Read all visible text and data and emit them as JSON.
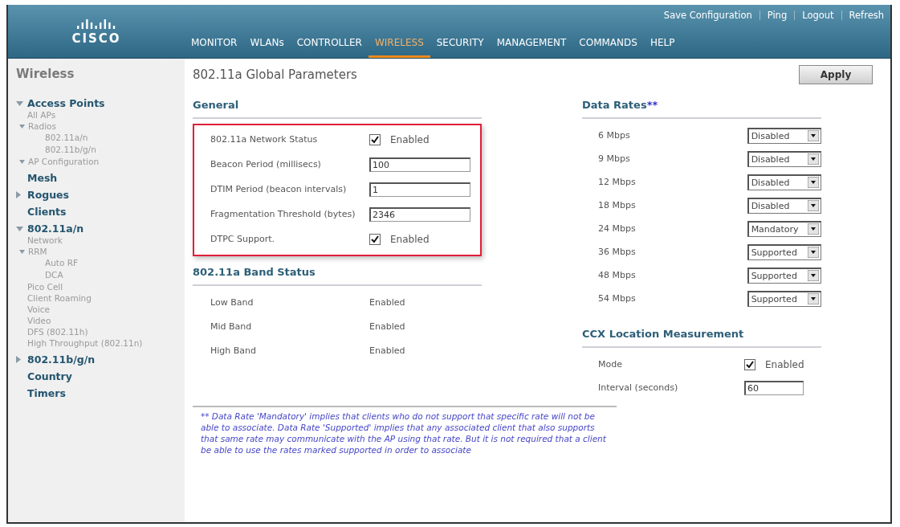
{
  "header": {
    "logo_text": "CISCO",
    "utility_links": [
      "Save Configuration",
      "Ping",
      "Logout",
      "Refresh"
    ],
    "nav": [
      {
        "label": "MONITOR",
        "selected": false
      },
      {
        "label": "WLANs",
        "selected": false
      },
      {
        "label": "CONTROLLER",
        "selected": false
      },
      {
        "label": "WIRELESS",
        "selected": true
      },
      {
        "label": "SECURITY",
        "selected": false
      },
      {
        "label": "MANAGEMENT",
        "selected": false
      },
      {
        "label": "COMMANDS",
        "selected": false
      },
      {
        "label": "HELP",
        "selected": false
      }
    ]
  },
  "sidebar": {
    "title": "Wireless",
    "items": [
      {
        "label": "Access Points",
        "expanded": true,
        "children": [
          {
            "label": "All APs"
          },
          {
            "label": "Radios",
            "expanded": true,
            "children": [
              {
                "label": "802.11a/n"
              },
              {
                "label": "802.11b/g/n"
              }
            ]
          },
          {
            "label": "AP Configuration",
            "expanded": true
          }
        ]
      },
      {
        "label": "Mesh"
      },
      {
        "label": "Rogues",
        "expanded": false
      },
      {
        "label": "Clients"
      },
      {
        "label": "802.11a/n",
        "expanded": true,
        "children": [
          {
            "label": "Network"
          },
          {
            "label": "RRM",
            "expanded": true,
            "children": [
              {
                "label": "Auto RF"
              },
              {
                "label": "DCA"
              }
            ]
          },
          {
            "label": "Pico Cell"
          },
          {
            "label": "Client Roaming"
          },
          {
            "label": "Voice"
          },
          {
            "label": "Video"
          },
          {
            "label": "DFS (802.11h)"
          },
          {
            "label": "High Throughput (802.11n)"
          }
        ]
      },
      {
        "label": "802.11b/g/n",
        "expanded": false
      },
      {
        "label": "Country"
      },
      {
        "label": "Timers"
      }
    ]
  },
  "page": {
    "title": "802.11a Global Parameters",
    "apply_button": "Apply"
  },
  "general": {
    "title": "General",
    "highlighted": true,
    "rows": [
      {
        "kind": "checkbox",
        "label": "802.11a Network Status",
        "checked": true,
        "option": "Enabled"
      },
      {
        "kind": "input",
        "label": "Beacon Period (millisecs)",
        "value": "100"
      },
      {
        "kind": "input",
        "label": "DTIM Period (beacon intervals)",
        "value": "1"
      },
      {
        "kind": "input",
        "label": "Fragmentation Threshold (bytes)",
        "value": "2346"
      },
      {
        "kind": "checkbox",
        "label": "DTPC Support.",
        "checked": true,
        "option": "Enabled"
      }
    ]
  },
  "band_status": {
    "title": "802.11a Band Status",
    "rows": [
      {
        "label": "Low Band",
        "value": "Enabled"
      },
      {
        "label": "Mid Band",
        "value": "Enabled"
      },
      {
        "label": "High Band",
        "value": "Enabled"
      }
    ]
  },
  "data_rates": {
    "title": "Data Rates",
    "title_mark": "**",
    "rows": [
      {
        "label": "6 Mbps",
        "value": "Disabled"
      },
      {
        "label": "9 Mbps",
        "value": "Disabled"
      },
      {
        "label": "12 Mbps",
        "value": "Disabled"
      },
      {
        "label": "18 Mbps",
        "value": "Disabled"
      },
      {
        "label": "24 Mbps",
        "value": "Mandatory"
      },
      {
        "label": "36 Mbps",
        "value": "Supported"
      },
      {
        "label": "48 Mbps",
        "value": "Supported"
      },
      {
        "label": "54 Mbps",
        "value": "Supported"
      }
    ]
  },
  "ccx": {
    "title": "CCX Location Measurement",
    "rows": [
      {
        "kind": "checkbox",
        "label": "Mode",
        "checked": true,
        "option": "Enabled"
      },
      {
        "kind": "input",
        "label": "Interval (seconds)",
        "value": "60"
      }
    ]
  },
  "footnote": "** Data Rate 'Mandatory' implies that clients who do not support that specific rate will not be able to associate. Data Rate 'Supported' implies that any associated client that also supports that same rate may communicate with the AP using that rate. But it is not required that a client be able to use the rates marked supported in order to associate"
}
